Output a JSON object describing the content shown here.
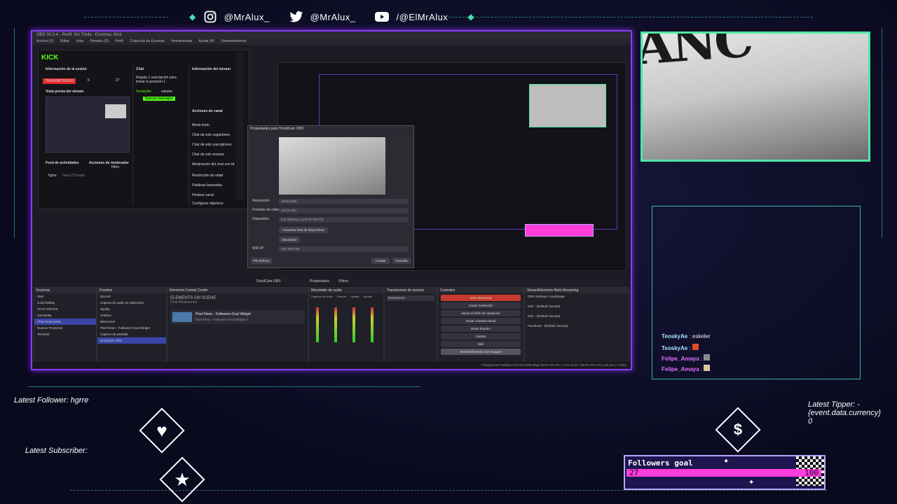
{
  "social": {
    "instagram": "@MrAlux_",
    "twitter": "@MrAlux_",
    "youtube": "/@ElMrAlux"
  },
  "obs": {
    "title": "OBS 30.0.4 - Perfil: Sin Título - Escenas: Kick",
    "menu": [
      "Archivo (F)",
      "Editar",
      "Vista",
      "Paneles (D)",
      "Perfil",
      "Colección de Escenas",
      "Herramientas",
      "Ayuda (H)",
      "Streamelements"
    ],
    "kick": {
      "logo": "KICK",
      "session_title": "Información de la sesión",
      "live_badge": "TRANSMITIENDO",
      "viewers": "6",
      "followers": "27",
      "preview_title": "Vista previa del stream",
      "chat_title": "Chat",
      "chat_gift": "Regala 1 suscripción para tomar la posición 1",
      "chat_user": "TeoskyAe",
      "chat_msg": "eskeler",
      "new_messages": "Nuevos mensajes",
      "activity_title": "Feed de actividades",
      "mod_title": "Acciones de moderador",
      "filter": "Filtro",
      "activity_user": "hgrre",
      "activity_text": "hace 23 horas",
      "stream_info": "Información del stream",
      "actions_title": "Acciones de canal",
      "actions": [
        "Modo lento",
        "Chat de solo seguidores",
        "Chat de solo suscriptores",
        "Chat de solo emotes",
        "Moderación del chat con IA",
        "Restricción de edad",
        "Palabras baneadas",
        "Hostear canal",
        "Configurar objetivos"
      ]
    },
    "dialog": {
      "title": "Propiedades para 'DroidCam OBS'",
      "rows": [
        {
          "label": "Resolución",
          "value": "1920x1080"
        },
        {
          "label": "Formato de vídeo",
          "value": "AVC/H.264"
        },
        {
          "label": "Dispositivo",
          "value": "(Un teléfono y wi-fi Rx (Wi-Fi))"
        }
      ],
      "refresh": "Actualizar lista de dispositivos",
      "disconnect": "Desactivar",
      "wifi_label": "WiFi IP",
      "wifi_value": "192.168.0.86",
      "defaults": "Por defecto",
      "accept": "Aceptar",
      "cancel": "Cancelar"
    },
    "source_bar": {
      "name": "DroidCam OBS",
      "properties": "Propiedades",
      "filters": "Filtros"
    },
    "docks": {
      "scenes": {
        "title": "Escenas",
        "items": [
          "Start",
          "JustChatting",
          "CHAT GRATIS",
          "Gameplay",
          "Chat Reacciones",
          "Nuevos Proyectos",
          "Terminar"
        ],
        "selected": 4
      },
      "sources": {
        "title": "Fuentes",
        "items": [
          "discord",
          "Captura de audio de aplicación",
          "Spotify",
          "chatbox",
          "Elementos",
          "Pixel Neon - Followers Goal Widget",
          "Captura de pantalla",
          "DroidCam OBS"
        ],
        "selected": 7
      },
      "elements": {
        "title": "Elements Central Center",
        "header": "ELEMENTS ON SCENE",
        "scene": "Chat Reacciones",
        "widget": "Pixel Neon - Followers Goal Widget",
        "widget_sub": "Pixel Neon - Followers Goal Widget 4"
      },
      "mixer": {
        "title": "Mezclador de audio",
        "channels": [
          "Captura de audio",
          "Discord",
          "Spotify",
          "Spotify"
        ]
      },
      "transitions": {
        "title": "Transiciones de escena",
        "value": "Desvanecer"
      },
      "controls": {
        "title": "Controles",
        "buttons": [
          "Stop Streaming",
          "Iniciar Grabación",
          "Iniciar el búfer de repetición",
          "Iniciar Cámara virtual",
          "Modo Estudio",
          "Ajustes",
          "Salir"
        ],
        "footer": "StreamElements Live Support"
      },
      "multistream": {
        "title": "StreamElements Multi-Streaming",
        "targets": [
          "OBS Settings / Landscape",
          "Kick - (Default Canvas)",
          "Kick - (Default Canvas)",
          "Facebook - (Default Canvas)"
        ]
      }
    },
    "status": "Fotogramas Perdidos 0 (0.0%)   6000 kbps   00:07:08   CPU: 4.1%   46.67 / 60.00 FPS   EN LIVE 25.1.7 (16x)"
  },
  "chat": [
    {
      "user": "TeoskyAe",
      "msg": "eskeler",
      "style": "u1"
    },
    {
      "user": "TeoskyAe",
      "msg": "",
      "style": "u1"
    },
    {
      "user": "Felipe_Amaya",
      "msg": "",
      "style": "u2"
    },
    {
      "user": "Felipe_Amaya",
      "msg": "",
      "style": "u2"
    }
  ],
  "overlay": {
    "latest_follower": "Latest Follower: hgrre",
    "latest_subscriber": "Latest Subscriber:",
    "latest_tipper": "Latest Tipper: -",
    "tipper_currency": "{event.data.currency}",
    "tipper_amount": "0"
  },
  "goal": {
    "title": "Followers goal",
    "current": "27",
    "max": "100"
  },
  "colors": {
    "accent_purple": "#8a3cf0",
    "accent_green": "#4ee8a4",
    "hud_cyan": "#3fc9c0",
    "goal_pink": "#ff3ed9"
  }
}
